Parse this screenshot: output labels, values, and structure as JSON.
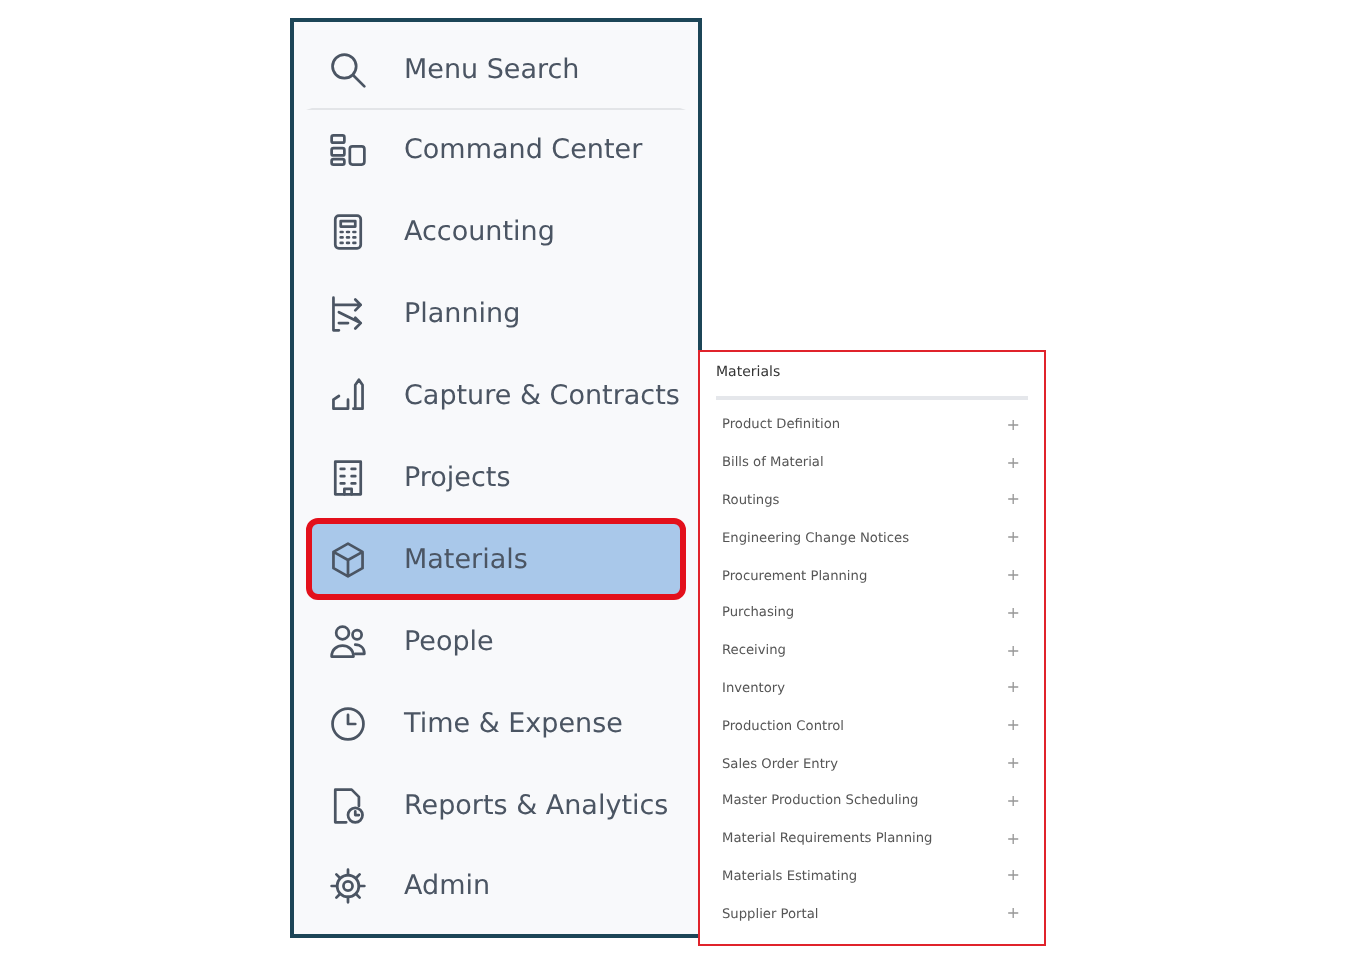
{
  "menu": {
    "search": {
      "label": "Menu Search"
    },
    "items": [
      {
        "label": "Command Center",
        "selected": false
      },
      {
        "label": "Accounting",
        "selected": false
      },
      {
        "label": "Planning",
        "selected": false
      },
      {
        "label": "Capture & Contracts",
        "selected": false
      },
      {
        "label": "Projects",
        "selected": false
      },
      {
        "label": "Materials",
        "selected": true
      },
      {
        "label": "People",
        "selected": false
      },
      {
        "label": "Time & Expense",
        "selected": false
      },
      {
        "label": "Reports & Analytics",
        "selected": false
      },
      {
        "label": "Admin",
        "selected": false
      }
    ]
  },
  "flyout": {
    "title": "Materials",
    "items": [
      {
        "label": "Product Definition",
        "expander": "+"
      },
      {
        "label": "Bills of Material",
        "expander": "+"
      },
      {
        "label": "Routings",
        "expander": "+"
      },
      {
        "label": "Engineering Change Notices",
        "expander": "+"
      },
      {
        "label": "Procurement Planning",
        "expander": "+"
      },
      {
        "label": "Purchasing",
        "expander": "+"
      },
      {
        "label": "Receiving",
        "expander": "+"
      },
      {
        "label": "Inventory",
        "expander": "+"
      },
      {
        "label": "Production Control",
        "expander": "+"
      },
      {
        "label": "Sales Order Entry",
        "expander": "+"
      },
      {
        "label": "Master Production Scheduling",
        "expander": "+"
      },
      {
        "label": "Material Requirements Planning",
        "expander": "+"
      },
      {
        "label": "Materials Estimating",
        "expander": "+"
      },
      {
        "label": "Supplier Portal",
        "expander": "+"
      }
    ]
  }
}
